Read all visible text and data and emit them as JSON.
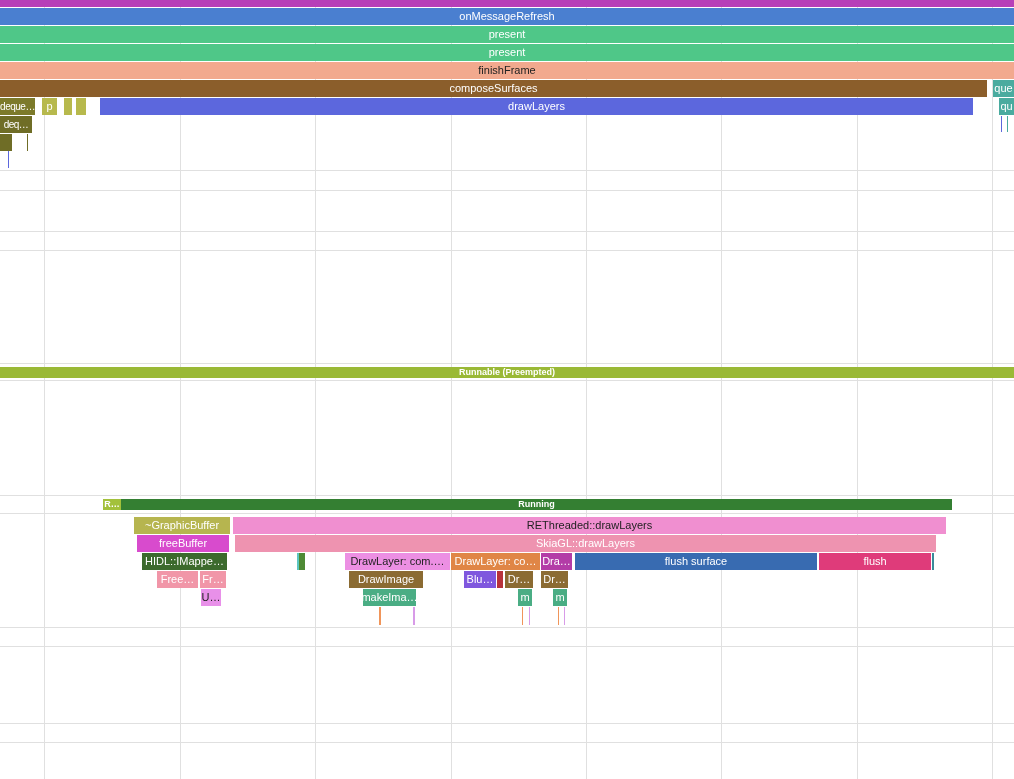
{
  "slices": [
    {
      "kind": "slice",
      "color": "#b73fb8"
    },
    {
      "kind": "slice",
      "name": "onMessageRefresh",
      "color": "#4a7fd0",
      "dark_label": false
    },
    {
      "kind": "slice",
      "name": "present",
      "color": "#4fc788",
      "dark_label": false
    },
    {
      "kind": "slice",
      "name": "present",
      "color": "#4fc788",
      "dark_label": false
    },
    {
      "kind": "slice",
      "name": "finishFrame",
      "color": "#f2a98e",
      "dark_label": true
    },
    {
      "kind": "slice",
      "name": "composeSurfaces",
      "color": "#8b5e2b",
      "dark_label": false
    },
    {
      "kind": "slice",
      "name": "que",
      "color": "#4aab9f",
      "dark_label": false
    },
    {
      "kind": "slice",
      "name": "deque…",
      "color": "#7c7a2a",
      "dark_label": false
    },
    {
      "kind": "slice",
      "name": "p",
      "color": "#b7b94d",
      "dark_label": false
    },
    {
      "kind": "slice",
      "color": "#b7b94d"
    },
    {
      "kind": "slice",
      "color": "#b7b94d"
    },
    {
      "kind": "slice",
      "name": "drawLayers",
      "color": "#5c67dd",
      "dark_label": false
    },
    {
      "kind": "slice",
      "name": "qu",
      "color": "#4aab9f",
      "dark_label": false
    },
    {
      "kind": "slice",
      "name": "deq…",
      "color": "#6f6d26",
      "dark_label": false
    },
    {
      "kind": "slice",
      "color": "#6f6d26"
    },
    {
      "kind": "line",
      "color": "#5c67dd"
    },
    {
      "kind": "line",
      "color": "#6f6d26"
    },
    {
      "kind": "line",
      "color": "#5c67dd"
    },
    {
      "kind": "line",
      "color": "#4aab9f"
    },
    {
      "kind": "state",
      "name": "Runnable (Preempted)",
      "color": "#9ab936",
      "dark_label": false
    },
    {
      "kind": "state",
      "name": "R…",
      "color": "#a3c13b",
      "dark_label": false
    },
    {
      "kind": "state",
      "name": "Running",
      "color": "#347f32",
      "dark_label": false
    },
    {
      "kind": "slice",
      "name": "~GraphicBuffer",
      "color": "#b6b54f",
      "dark_label": false
    },
    {
      "kind": "slice",
      "name": "REThreaded::drawLayers",
      "color": "#f08fd0",
      "dark_label": true
    },
    {
      "kind": "slice",
      "name": "freeBuffer",
      "color": "#d84bcd",
      "dark_label": false
    },
    {
      "kind": "slice",
      "name": "SkiaGL::drawLayers",
      "color": "#ee93b0",
      "dark_label": false
    },
    {
      "kind": "slice",
      "name": "HIDL::IMappe…",
      "color": "#3c6a2d",
      "dark_label": false
    },
    {
      "kind": "slice",
      "color": "#5cc6c0"
    },
    {
      "kind": "slice",
      "color": "#4e8a35"
    },
    {
      "kind": "slice",
      "name": "DrawLayer: com.…",
      "color": "#ec8fe3",
      "dark_label": true
    },
    {
      "kind": "slice",
      "name": "DrawLayer: co…",
      "color": "#e08646",
      "dark_label": false
    },
    {
      "kind": "slice",
      "name": "Dra…",
      "color": "#b33ca7",
      "dark_label": false
    },
    {
      "kind": "slice",
      "name": "flush surface",
      "color": "#386bb1",
      "dark_label": false
    },
    {
      "kind": "slice",
      "name": "flush",
      "color": "#df3b7a",
      "dark_label": false
    },
    {
      "kind": "slice",
      "color": "#3a8a9a"
    },
    {
      "kind": "slice",
      "name": "Free…",
      "color": "#f196a8",
      "dark_label": false
    },
    {
      "kind": "slice",
      "name": "Fr…",
      "color": "#f196a8",
      "dark_label": false
    },
    {
      "kind": "slice",
      "name": "DrawImage",
      "color": "#8b6b32",
      "dark_label": false
    },
    {
      "kind": "slice",
      "name": "Blu…",
      "color": "#7f57de",
      "dark_label": false
    },
    {
      "kind": "slice",
      "color": "#b8323a"
    },
    {
      "kind": "slice",
      "name": "Dr…",
      "color": "#8b6b32",
      "dark_label": false
    },
    {
      "kind": "slice",
      "name": "Dr…",
      "color": "#8b6b32",
      "dark_label": false
    },
    {
      "kind": "slice",
      "name": "U…",
      "color": "#e890e9",
      "dark_label": true
    },
    {
      "kind": "slice",
      "name": "makeIma…",
      "color": "#4aad84",
      "dark_label": false
    },
    {
      "kind": "slice",
      "name": "m",
      "color": "#4aad84",
      "dark_label": false
    },
    {
      "kind": "slice",
      "name": "m",
      "color": "#4aad84",
      "dark_label": false
    },
    {
      "kind": "line",
      "color": "#f0955a"
    },
    {
      "kind": "line",
      "color": "#d89be8"
    },
    {
      "kind": "line",
      "color": "#f0955a"
    },
    {
      "kind": "line",
      "color": "#d89be8"
    },
    {
      "kind": "line",
      "color": "#f0955a"
    },
    {
      "kind": "line",
      "color": "#d89be8"
    }
  ]
}
